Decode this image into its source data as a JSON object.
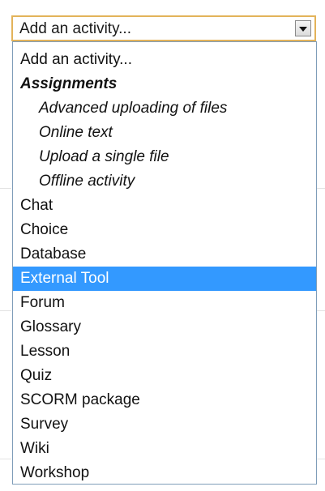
{
  "select": {
    "value": "Add an activity..."
  },
  "options": [
    {
      "label": "Add an activity...",
      "type": "option",
      "selected": false
    },
    {
      "label": "Assignments",
      "type": "group",
      "selected": false
    },
    {
      "label": "Advanced uploading of files",
      "type": "sub",
      "selected": false
    },
    {
      "label": "Online text",
      "type": "sub",
      "selected": false
    },
    {
      "label": "Upload a single file",
      "type": "sub",
      "selected": false
    },
    {
      "label": "Offline activity",
      "type": "sub",
      "selected": false
    },
    {
      "label": "Chat",
      "type": "option",
      "selected": false
    },
    {
      "label": "Choice",
      "type": "option",
      "selected": false
    },
    {
      "label": "Database",
      "type": "option",
      "selected": false
    },
    {
      "label": "External Tool",
      "type": "option",
      "selected": true
    },
    {
      "label": "Forum",
      "type": "option",
      "selected": false
    },
    {
      "label": "Glossary",
      "type": "option",
      "selected": false
    },
    {
      "label": "Lesson",
      "type": "option",
      "selected": false
    },
    {
      "label": "Quiz",
      "type": "option",
      "selected": false
    },
    {
      "label": "SCORM package",
      "type": "option",
      "selected": false
    },
    {
      "label": "Survey",
      "type": "option",
      "selected": false
    },
    {
      "label": "Wiki",
      "type": "option",
      "selected": false
    },
    {
      "label": "Workshop",
      "type": "option",
      "selected": false
    }
  ],
  "colors": {
    "focus_border": "#e3b35a",
    "list_border": "#7f9db9",
    "highlight": "#3399ff",
    "highlight_text": "#ffffff"
  },
  "icons": {
    "dropdown": "chevron-down-icon"
  }
}
